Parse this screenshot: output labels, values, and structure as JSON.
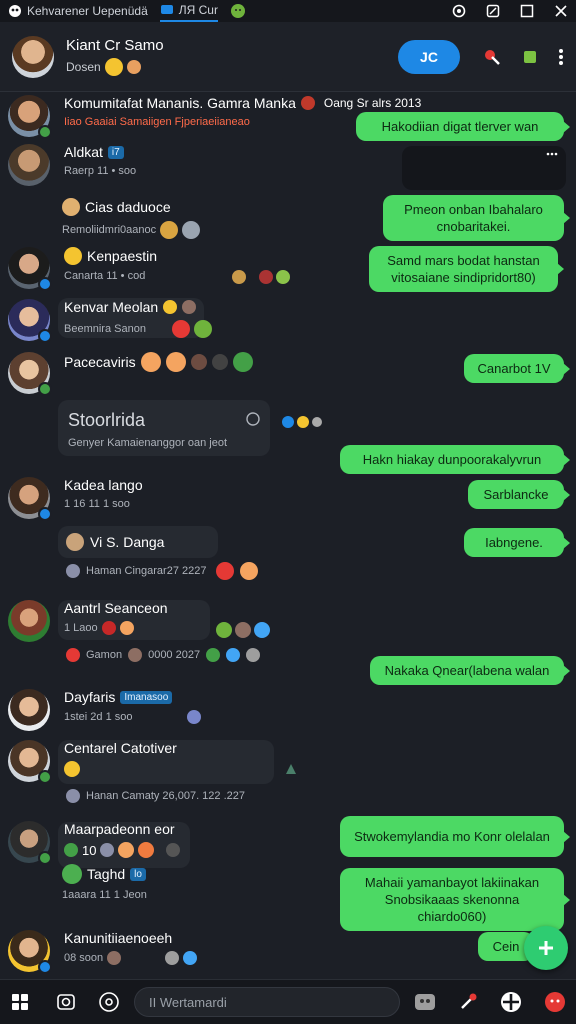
{
  "topbar": {
    "tabs": [
      {
        "label": "Kehvarener Uepenüdä",
        "icon": "app-icon"
      },
      {
        "label": "ЛЯ Cur",
        "icon": "chat-icon"
      }
    ],
    "window_buttons": [
      "settings-icon",
      "edit-icon",
      "maximize-icon",
      "close-icon"
    ]
  },
  "header": {
    "name": "Kiant Cr Samo",
    "status": "Dosen",
    "action_label": "JC"
  },
  "messages": {
    "m1": {
      "name": "Komumitafat Mananis. Gamra Manka",
      "tag": "Oang Sr alrs 2013",
      "sub": "Iiao Gaaiai Samaiigen Fjperiaeiianeao",
      "bubble": "Hakodiian digat tlerver wan"
    },
    "m2": {
      "name": "Aldkat",
      "tag": "i7",
      "time": "Raerp 11 • soo"
    },
    "m3": {
      "name": "Cias daduoce",
      "time": "Remoliidmri0aanoc"
    },
    "g1": "Pmeon onban Ibahalaro cnobaritakei.",
    "m4": {
      "name": "Kenpaestin",
      "time": "Canarta 11 • cod"
    },
    "g2": "Samd mars bodat hanstan vitosaiane sindipridort80)",
    "m5": {
      "name": "Kenvar Meolan",
      "time": "Beemnira Sanon"
    },
    "m6": {
      "name": "Pacecaviris",
      "bubble": "Canarbot 1V"
    },
    "m7": {
      "title": "Stoorlrida",
      "sub": "Genyer Kamaienanggor oan jeot"
    },
    "g3": "Hakn hiakay dunpoorakalyvrun",
    "m8": {
      "name": "Kadea lango",
      "time": "1 16 11 1 soo",
      "bubble": "Sarblancke"
    },
    "g4": "Iabngene.",
    "m9": {
      "name": "Vi S. Danga",
      "time": "Haman Cingarar27 2227"
    },
    "m10": {
      "name": "Aantrl Seanceon",
      "time": "1 Laoo",
      "sub": "Gamon",
      "code": "0000 2027"
    },
    "g5": "Nakaka Qnear(labena walan",
    "m11": {
      "name": "Dayfaris",
      "tag": "Imanasoo",
      "time": "1stei 2d 1 soo"
    },
    "m12": {
      "name": "Centarel Catotiver",
      "time": "Hanan Camaty 26,007. 122 .227"
    },
    "m13": {
      "name": "Maarpadeonn eor",
      "count": "10"
    },
    "g6": "Stwokemylandia mo Konr olelalan",
    "m14": {
      "name": "Taghd",
      "tag": "lo",
      "time": "1aaara 11 1 Jeon"
    },
    "g7": "Mahaii yamanbayot lakiinakan Snobsikaaas skenonna chiardo060)",
    "m15": {
      "name": "Kanunitiiaenoeeh",
      "time": "08 soon",
      "bubble": "Cein"
    }
  },
  "composer": {
    "placeholder": "II Wertamardi"
  },
  "colors": {
    "accent": "#1e88e5",
    "bubble_green": "#4cd964",
    "background": "#1c1f26"
  }
}
